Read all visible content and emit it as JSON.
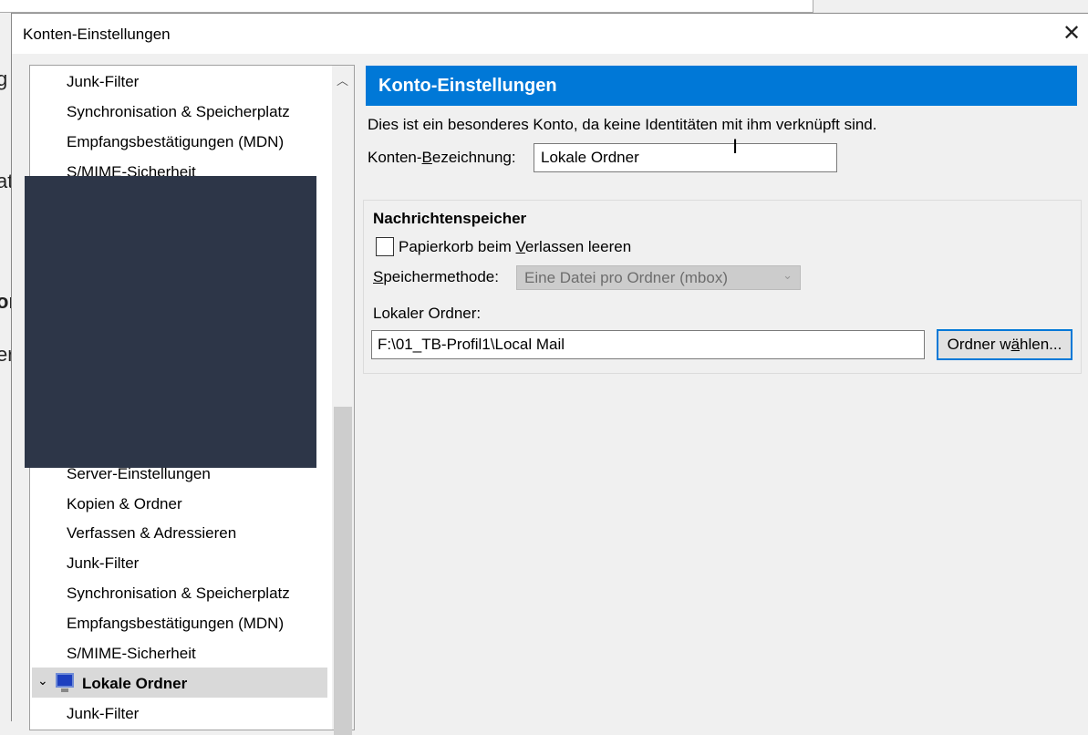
{
  "background_fragments": [
    "g",
    "at",
    "or",
    "er"
  ],
  "dialog": {
    "title": "Konten-Einstellungen",
    "close_icon": "close-icon"
  },
  "tree": {
    "items_top": [
      "Junk-Filter",
      "Synchronisation & Speicherplatz",
      "Empfangsbestätigungen (MDN)",
      "S/MIME-Sicherheit"
    ],
    "items_bottom": [
      "Server-Einstellungen",
      "Kopien & Ordner",
      "Verfassen & Adressieren",
      "Junk-Filter",
      "Synchronisation & Speicherplatz",
      "Empfangsbestätigungen (MDN)",
      "S/MIME-Sicherheit"
    ],
    "selected": {
      "label": "Lokale Ordner",
      "icon": "computer-icon"
    },
    "after_selected": [
      "Junk-Filter"
    ]
  },
  "panel": {
    "header": "Konto-Einstellungen",
    "description": "Dies ist ein besonderes Konto, da keine Identitäten mit ihm verknüpft sind.",
    "name_label_pre": "Konten-",
    "name_label_ul": "B",
    "name_label_post": "ezeichnung:",
    "name_value": "Lokale Ordner",
    "group_title": "Nachrichtenspeicher",
    "empty_trash": {
      "pre": "Papierkorb beim ",
      "ul": "V",
      "post": "erlassen leeren",
      "checked": false
    },
    "store_label_ul": "S",
    "store_label_post": "peichermethode:",
    "store_value": "Eine Datei pro Ordner (mbox)",
    "local_folder_label": "Lokaler Ordner:",
    "local_folder_value": "F:\\01_TB-Profil1\\Local Mail",
    "choose_pre": "Ordner w",
    "choose_ul": "ä",
    "choose_post": "hlen..."
  },
  "colors": {
    "accent": "#0078d7",
    "redaction": "#2d3648"
  }
}
